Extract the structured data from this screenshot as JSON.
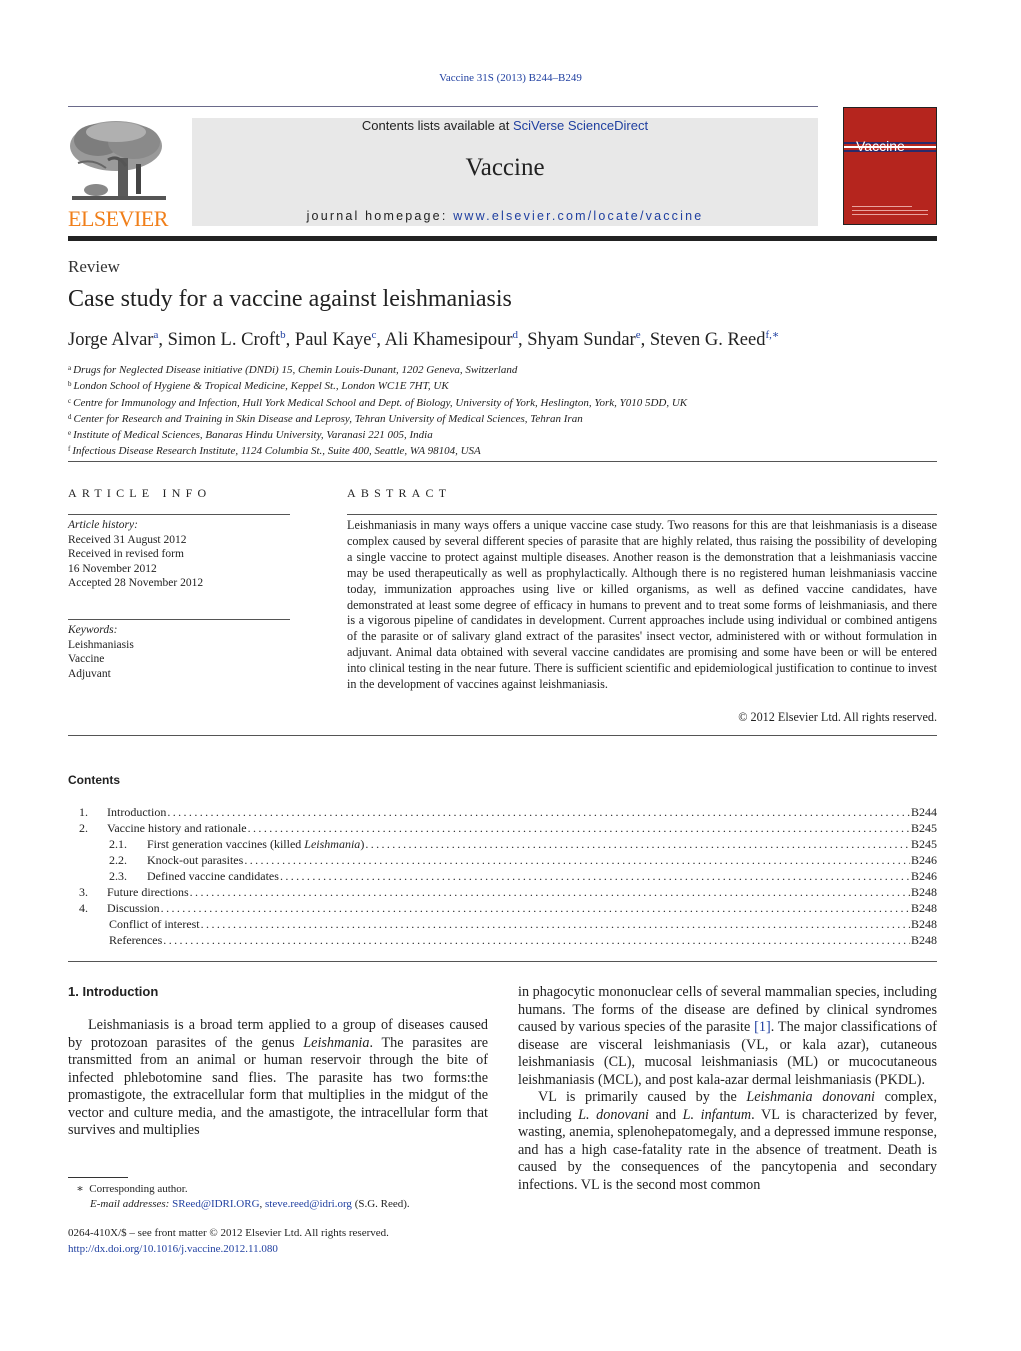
{
  "citation": "Vaccine 31S (2013) B244–B249",
  "header": {
    "publisher_wordmark": "ELSEVIER",
    "contents_available_prefix": "Contents lists available at ",
    "contents_available_link": "SciVerse ScienceDirect",
    "journal_name": "Vaccine",
    "homepage_prefix": "journal homepage: ",
    "homepage_link": "www.elsevier.com/locate/vaccine",
    "cover_title": "Vaccine",
    "colors": {
      "cover_red": "#b5251e",
      "publisher_orange": "#f07f1a",
      "link_blue": "#1f3fa0",
      "banner_gray": "#e8e8e8"
    }
  },
  "article": {
    "type": "Review",
    "title": "Case study for a vaccine against leishmaniasis",
    "authors": [
      {
        "name": "Jorge Alvar",
        "sup": "a"
      },
      {
        "name": "Simon L. Croft",
        "sup": "b"
      },
      {
        "name": "Paul Kaye",
        "sup": "c"
      },
      {
        "name": "Ali Khamesipour",
        "sup": "d"
      },
      {
        "name": "Shyam Sundar",
        "sup": "e"
      },
      {
        "name": "Steven G. Reed",
        "sup": "f,∗"
      }
    ],
    "affiliations": [
      {
        "key": "a",
        "text": "Drugs for Neglected Disease initiative (DNDi) 15, Chemin Louis-Dunant, 1202 Geneva, Switzerland"
      },
      {
        "key": "b",
        "text": "London School of Hygiene & Tropical Medicine, Keppel St., London WC1E 7HT, UK"
      },
      {
        "key": "c",
        "text": "Centre for Immunology and Infection, Hull York Medical School and Dept. of Biology, University of York, Heslington, York, Y010 5DD, UK"
      },
      {
        "key": "d",
        "text": "Center for Research and Training in Skin Disease and Leprosy, Tehran University of Medical Sciences, Tehran Iran"
      },
      {
        "key": "e",
        "text": "Institute of Medical Sciences, Banaras Hindu University, Varanasi 221 005, India"
      },
      {
        "key": "f",
        "text": "Infectious Disease Research Institute, 1124 Columbia St., Suite 400, Seattle, WA 98104, USA"
      }
    ]
  },
  "article_info": {
    "heading": "ARTICLE INFO",
    "history_label": "Article history:",
    "history": [
      "Received 31 August 2012",
      "Received in revised form",
      "16 November 2012",
      "Accepted 28 November 2012"
    ],
    "keywords_label": "Keywords:",
    "keywords": [
      "Leishmaniasis",
      "Vaccine",
      "Adjuvant"
    ]
  },
  "abstract": {
    "heading": "ABSTRACT",
    "text": "Leishmaniasis in many ways offers a unique vaccine case study. Two reasons for this are that leishmaniasis is a disease complex caused by several different species of parasite that are highly related, thus raising the possibility of developing a single vaccine to protect against multiple diseases. Another reason is the demonstration that a leishmaniasis vaccine may be used therapeutically as well as prophylactically. Although there is no registered human leishmaniasis vaccine today, immunization approaches using live or killed organisms, as well as defined vaccine candidates, have demonstrated at least some degree of efficacy in humans to prevent and to treat some forms of leishmaniasis, and there is a vigorous pipeline of candidates in development. Current approaches include using individual or combined antigens of the parasite or of salivary gland extract of the parasites' insect vector, administered with or without formulation in adjuvant. Animal data obtained with several vaccine candidates are promising and some have been or will be entered into clinical testing in the near future. There is sufficient scientific and epidemiological justification to continue to invest in the development of vaccines against leishmaniasis.",
    "copyright": "© 2012 Elsevier Ltd. All rights reserved."
  },
  "contents": {
    "heading": "Contents",
    "items": [
      {
        "num": "1.",
        "title": "Introduction",
        "title_italic": "",
        "title_suffix": "",
        "page": "B244",
        "level": 1
      },
      {
        "num": "2.",
        "title": "Vaccine history and rationale",
        "title_italic": "",
        "title_suffix": "",
        "page": "B245",
        "level": 1
      },
      {
        "num": "2.1.",
        "title": "First generation vaccines (killed ",
        "title_italic": "Leishmania",
        "title_suffix": ")",
        "page": "B245",
        "level": 2
      },
      {
        "num": "2.2.",
        "title": "Knock-out parasites",
        "title_italic": "",
        "title_suffix": "",
        "page": "B246",
        "level": 2
      },
      {
        "num": "2.3.",
        "title": "Defined vaccine candidates",
        "title_italic": "",
        "title_suffix": "",
        "page": "B246",
        "level": 2
      },
      {
        "num": "3.",
        "title": "Future directions",
        "title_italic": "",
        "title_suffix": "",
        "page": "B248",
        "level": 1
      },
      {
        "num": "4.",
        "title": "Discussion",
        "title_italic": "",
        "title_suffix": "",
        "page": "B248",
        "level": 1
      },
      {
        "num": "",
        "title": "Conflict of interest",
        "title_italic": "",
        "title_suffix": "",
        "page": "B248",
        "level": 0
      },
      {
        "num": "",
        "title": "References",
        "title_italic": "",
        "title_suffix": "",
        "page": "B248",
        "level": 0
      }
    ]
  },
  "body": {
    "intro_heading": "1.  Introduction",
    "left_para": {
      "t1": "Leishmaniasis is a broad term applied to a group of diseases caused by protozoan parasites of the genus ",
      "i1": "Leishmania",
      "t2": ". The parasites are transmitted from an animal or human reservoir through the bite of infected phlebotomine sand flies. The parasite has two forms:the promastigote, the extracellular form that multiplies in the midgut of the vector and culture media, and the amastigote, the intracellular form that survives and multiplies"
    },
    "right_para1": {
      "t1": "in phagocytic mononuclear cells of several mammalian species, including humans. The forms of the disease are defined by clinical syndromes caused by various species of the parasite ",
      "ref": "[1]",
      "t2": ". The major classifications of disease are visceral leishmaniasis (VL, or kala azar), cutaneous leishmaniasis (CL), mucosal leishmaniasis (ML) or mucocutaneous leishmaniasis (MCL), and post kala-azar dermal leishmaniasis (PKDL)."
    },
    "right_para2": {
      "t1": "VL is primarily caused by the ",
      "i1": "Leishmania donovani",
      "t2": " complex, including ",
      "i2": "L. donovani",
      "t3": " and ",
      "i3": "L. infantum",
      "t4": ". VL is characterized by fever, wasting, anemia, splenohepatomegaly, and a depressed immune response, and has a high case-fatality rate in the absence of treatment. Death is caused by the consequences of the pancytopenia and secondary infections. VL is the second most common"
    }
  },
  "footnotes": {
    "corresponding_mark": "∗",
    "corresponding_text": "Corresponding author.",
    "email_label": "E-mail addresses:",
    "email_1": "SReed@IDRI.ORG",
    "email_sep": ", ",
    "email_2": "steve.reed@idri.org",
    "email_suffix": " (S.G. Reed).",
    "issn_line": "0264-410X/$ – see front matter © 2012 Elsevier Ltd. All rights reserved.",
    "doi": "http://dx.doi.org/10.1016/j.vaccine.2012.11.080"
  }
}
